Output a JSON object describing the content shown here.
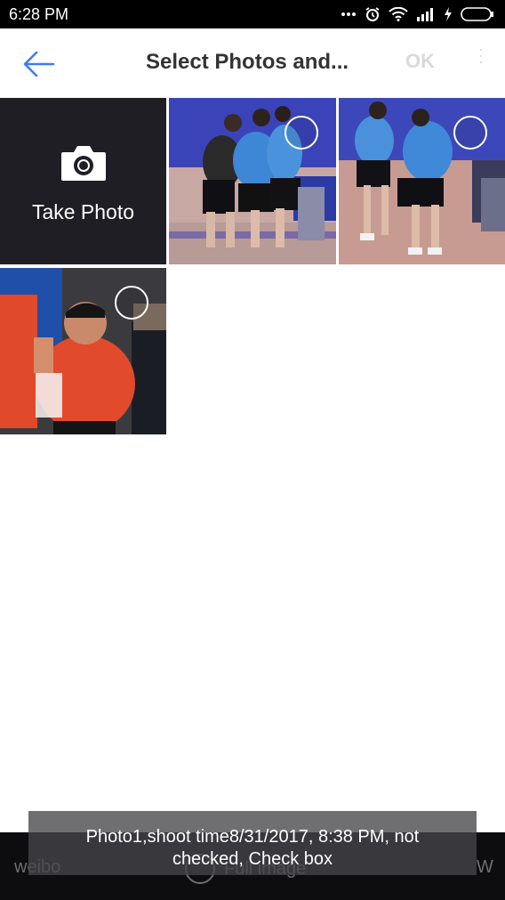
{
  "status_bar": {
    "time": "6:28 PM",
    "icons": [
      "more-dots-icon",
      "alarm-icon",
      "wifi-icon",
      "signal-icon",
      "charging-icon",
      "battery-icon"
    ]
  },
  "header": {
    "title": "Select Photos and...",
    "ok_label": "OK",
    "back_icon": "back-arrow-icon",
    "accent_color": "#3d7cf0"
  },
  "grid": {
    "take_photo_label": "Take Photo",
    "photos": [
      {
        "name": "photo-1",
        "selected": false
      },
      {
        "name": "photo-2",
        "selected": false
      },
      {
        "name": "photo-3",
        "selected": false
      }
    ]
  },
  "bottom_bar": {
    "left_label": "weibo",
    "center_label": "Full image",
    "right_label": "W"
  },
  "toast": {
    "line1": "Photo1,shoot time8/31/2017, 8:38 PM, not",
    "line2": "checked, Check box"
  }
}
